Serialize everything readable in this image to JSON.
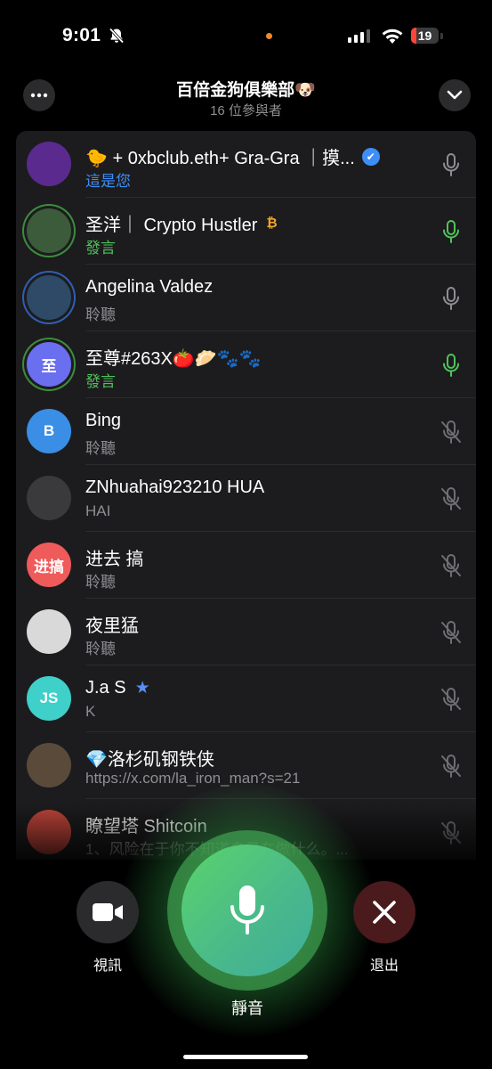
{
  "status_bar": {
    "time": "9:01",
    "battery": "19",
    "battery_level": 0.19,
    "signal_bars": 3,
    "icons": [
      "bell-slash-icon",
      "signal-icon",
      "wifi-icon",
      "battery-icon"
    ],
    "privacy_dot_color": "#f08a24",
    "battery_fill_color": "#ff453a"
  },
  "header": {
    "title": "百倍金狗俱樂部🐶",
    "participants": "16 位參與者"
  },
  "colors": {
    "speaking": "#4fc35a",
    "muted_icon": "#6e6e73",
    "idle_icon": "#8e8e93",
    "self_label": "#3e8ef7"
  },
  "participants": [
    {
      "name": "🐤 + 0xbclub.eth+ Gra-Gra ｜摸...",
      "badge": "✔",
      "badge_icon": "verified-icon",
      "status": "這是您",
      "status_type": "blue",
      "mic": "idle",
      "avatar_text": "",
      "avatar_bg": "#5b2a8f",
      "ring": ""
    },
    {
      "name": "圣洋｜ Crypto Hustler",
      "badge": "₿",
      "badge_icon": "bitcoin-icon",
      "status": "發言",
      "status_type": "green",
      "mic": "speaking",
      "avatar_text": "",
      "avatar_bg": "#3b5b3a",
      "ring": "ring-green"
    },
    {
      "name": "Angelina Valdez",
      "badge": "",
      "badge_icon": "",
      "status": "聆聽",
      "status_type": "gray",
      "mic": "idle",
      "avatar_text": "",
      "avatar_bg": "#2e4a66",
      "ring": "ring-blue"
    },
    {
      "name": "至尊#263X🍅🥟🐾🐾",
      "badge": "",
      "badge_icon": "",
      "status": "發言",
      "status_type": "green",
      "mic": "speaking",
      "avatar_text": "至",
      "avatar_bg": "#6a6ff0",
      "ring": "ring-green"
    },
    {
      "name": "Bing",
      "badge": "",
      "badge_icon": "",
      "status": "聆聽",
      "status_type": "gray",
      "mic": "muted",
      "avatar_text": "B",
      "avatar_bg": "#3a8ee6",
      "ring": ""
    },
    {
      "name": "ZNhuahai923210 HUA",
      "badge": "",
      "badge_icon": "",
      "status": "HAI",
      "status_type": "gray",
      "mic": "muted",
      "avatar_text": "",
      "avatar_bg": "#3a3a3c",
      "ring": ""
    },
    {
      "name": "进去 搞",
      "badge": "",
      "badge_icon": "",
      "status": "聆聽",
      "status_type": "gray",
      "mic": "muted",
      "avatar_text": "进搞",
      "avatar_bg": "#ef5a5a",
      "ring": ""
    },
    {
      "name": "夜里猛",
      "badge": "",
      "badge_icon": "",
      "status": "聆聽",
      "status_type": "gray",
      "mic": "muted",
      "avatar_text": "",
      "avatar_bg": "#d9d9d9",
      "ring": ""
    },
    {
      "name": "J.a S",
      "badge": "★",
      "badge_icon": "star-icon",
      "status": "K",
      "status_type": "gray",
      "mic": "muted",
      "avatar_text": "JS",
      "avatar_bg": "#3fd0c9",
      "ring": ""
    },
    {
      "name": "💎洛杉矶钢铁侠",
      "badge": "",
      "badge_icon": "",
      "status": "https://x.com/la_iron_man?s=21",
      "status_type": "gray",
      "mic": "muted",
      "avatar_text": "",
      "avatar_bg": "#5a4a3a",
      "ring": ""
    },
    {
      "name": "瞭望塔 Shitcoin",
      "badge": "",
      "badge_icon": "",
      "status": "1、风险在于你不知道自己在做什么。...",
      "status_type": "gray",
      "mic": "muted",
      "avatar_text": "",
      "avatar_bg": "#c0453a",
      "ring": ""
    }
  ],
  "controls": {
    "video_label": "視訊",
    "mute_label": "靜音",
    "leave_label": "退出"
  }
}
